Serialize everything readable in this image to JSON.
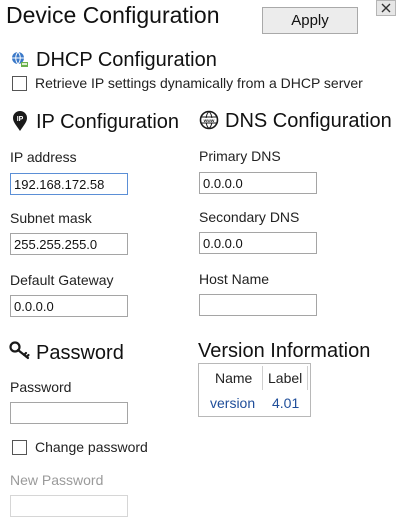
{
  "window": {
    "title": "Device Configuration",
    "apply_label": "Apply",
    "close_glyph": "✕"
  },
  "dhcp": {
    "title": "DHCP Configuration",
    "icon": "network-globe-icon",
    "checkbox_label": "Retrieve IP settings dynamically from a DHCP server",
    "checked": false
  },
  "ip": {
    "title": "IP Configuration",
    "icon": "map-pin-icon",
    "ip_label": "IP address",
    "ip_value": "192.168.172.58",
    "subnet_label": "Subnet mask",
    "subnet_value": "255.255.255.0",
    "gateway_label": "Default Gateway",
    "gateway_value": "0.0.0.0"
  },
  "dns": {
    "title": "DNS Configuration",
    "icon": "www-globe-icon",
    "primary_label": "Primary DNS",
    "primary_value": "0.0.0.0",
    "secondary_label": "Secondary DNS",
    "secondary_value": "0.0.0.0",
    "host_label": "Host Name",
    "host_value": ""
  },
  "password": {
    "title": "Password",
    "icon": "key-icon",
    "password_label": "Password",
    "password_value": "",
    "change_label": "Change password",
    "change_checked": false,
    "new_label": "New Password",
    "new_value": ""
  },
  "version": {
    "title": "Version Information",
    "columns": [
      "Name",
      "Label"
    ],
    "rows": [
      {
        "name": "version",
        "label": "4.01"
      }
    ]
  },
  "colors": {
    "accent_blue": "#1f4e9a",
    "focus_border": "#5b8fd6",
    "disabled_text": "#9a9a9a"
  }
}
